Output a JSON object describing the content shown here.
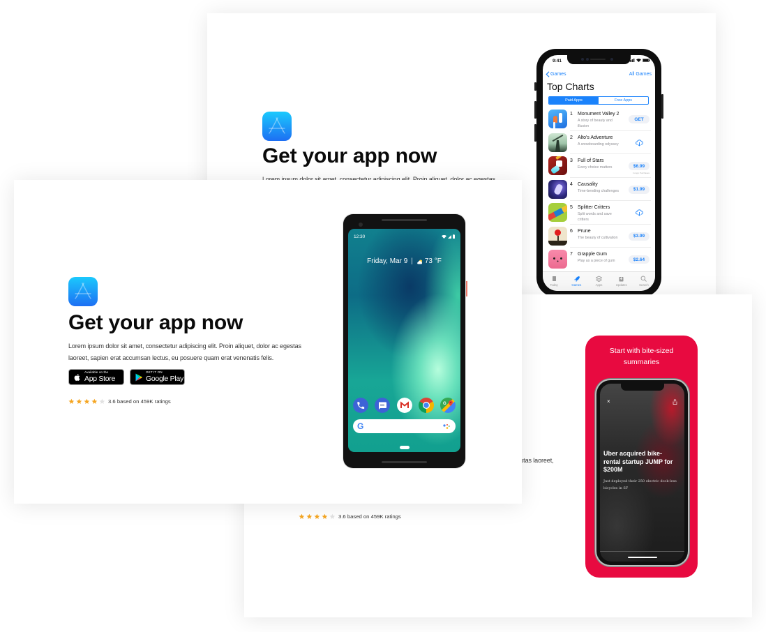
{
  "colors": {
    "accent_blue": "#1a82fb",
    "star": "#f5a623",
    "star_empty": "#e2e2e2",
    "promo_red": "#e80a40"
  },
  "cards": {
    "top": {
      "icon": "app-store-icon",
      "title": "Get your app now",
      "description": "Lorem ipsum dolor sit amet, consectetur adipiscing elit. Proin aliquet, dolor ac egestas",
      "phone": {
        "status_time": "9:41",
        "nav_back": "Games",
        "nav_right": "All Games",
        "title": "Top Charts",
        "segments": [
          {
            "label": "Paid Apps",
            "active": true
          },
          {
            "label": "Free Apps",
            "active": false
          }
        ],
        "apps": [
          {
            "rank": "1",
            "name": "Monument Valley 2",
            "subtitle": "A story of beauty and illusion",
            "icon": "monument-valley-2",
            "action": {
              "type": "get",
              "label": "GET"
            }
          },
          {
            "rank": "2",
            "name": "Alto's Adventure",
            "subtitle": "A snowboarding odyssey",
            "icon": "altos-adventure",
            "action": {
              "type": "download",
              "label": ""
            }
          },
          {
            "rank": "3",
            "name": "Full of Stars",
            "subtitle": "Every choice matters",
            "icon": "full-of-stars",
            "action": {
              "type": "price",
              "label": "$6.99"
            },
            "note": "In-App Purchases"
          },
          {
            "rank": "4",
            "name": "Causality",
            "subtitle": "Time-bending challenges",
            "icon": "causality",
            "action": {
              "type": "price",
              "label": "$1.99"
            }
          },
          {
            "rank": "5",
            "name": "Splitter Critters",
            "subtitle": "Split words and save critters",
            "icon": "splitter-critters",
            "action": {
              "type": "download",
              "label": ""
            }
          },
          {
            "rank": "6",
            "name": "Prune",
            "subtitle": "The beauty of cultivation",
            "icon": "prune",
            "action": {
              "type": "price",
              "label": "$3.99"
            }
          },
          {
            "rank": "7",
            "name": "Grapple Gum",
            "subtitle": "Play as a piece of gum",
            "icon": "grapple-gum",
            "action": {
              "type": "price",
              "label": "$2.64"
            }
          }
        ],
        "tabs": [
          {
            "label": "Today",
            "icon": "today",
            "active": false
          },
          {
            "label": "Games",
            "icon": "rocket",
            "active": true
          },
          {
            "label": "Apps",
            "icon": "layers",
            "active": false
          },
          {
            "label": "Updates",
            "icon": "updates",
            "active": false
          },
          {
            "label": "Search",
            "icon": "search",
            "active": false
          }
        ]
      }
    },
    "left": {
      "icon": "app-store-icon",
      "title": "Get your app now",
      "description": "Lorem ipsum dolor sit amet, consectetur adipiscing elit. Proin aliquet, dolor ac egestas laoreet, sapien erat accumsan lectus, eu posuere quam erat venenatis felis.",
      "badges": {
        "app_store": {
          "small": "Available on the",
          "big": "App Store"
        },
        "google_play": {
          "small": "GET IT ON",
          "big": "Google Play"
        }
      },
      "rating": {
        "value": 3.6,
        "stars_filled": 4,
        "stars_total": 5,
        "label": "3.6 based on 459K ratings"
      },
      "phone": {
        "status_time": "12:30",
        "date": "Friday, Mar 9",
        "divider": "|",
        "temperature": "73 °F",
        "dock": [
          "phone",
          "messages",
          "gmail",
          "chrome",
          "maps"
        ]
      }
    },
    "bottom": {
      "description": "Lorem ipsum dolor sit amet, consectetur adipiscing elit. Proin aliquet, dolor ac egestas laoreet,",
      "rating": {
        "value": 3.6,
        "stars_filled": 4,
        "stars_total": 5,
        "label": "3.6 based on 459K ratings"
      },
      "promo": {
        "heading": "Start with bite-sized summaries",
        "close_glyph": "×",
        "article_headline": "Uber acquired bike-rental startup JUMP for $200M",
        "article_summary": "Just deployed their 250 electric dock-less bicycles in SF"
      }
    }
  }
}
